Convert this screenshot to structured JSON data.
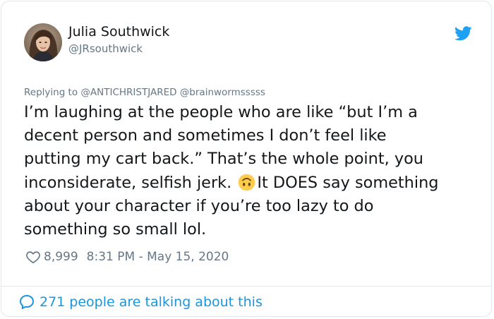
{
  "author": {
    "display_name": "Julia Southwick",
    "handle": "@JRsouthwick",
    "avatar_icon": "profile-photo",
    "platform_icon": "twitter-bird-icon"
  },
  "reply": {
    "prefix": "Replying to",
    "mentions": "@ANTICHRISTJARED @brainwormsssss"
  },
  "tweet": {
    "line1": "I’m laughing at the people who are like “but I’m a",
    "line2": "decent person and sometimes I don’t feel like",
    "line3": "putting my cart back.” That’s the whole point, you",
    "line4_before_emoji": "inconsiderate, selfish jerk. ",
    "line4_emoji": "upside-down-face-emoji",
    "line4_after_emoji": "It DOES say something",
    "line5": "about your character if you’re too lazy to do",
    "line6": "something so small lol."
  },
  "meta": {
    "likes": "8,999",
    "timestamp": "8:31 PM - May 15, 2020"
  },
  "footer": {
    "conversation_text": "271 people are talking about this"
  },
  "colors": {
    "text": "#14171a",
    "secondary": "#657786",
    "accent": "#1b95e0",
    "border": "#e1e8ed"
  }
}
